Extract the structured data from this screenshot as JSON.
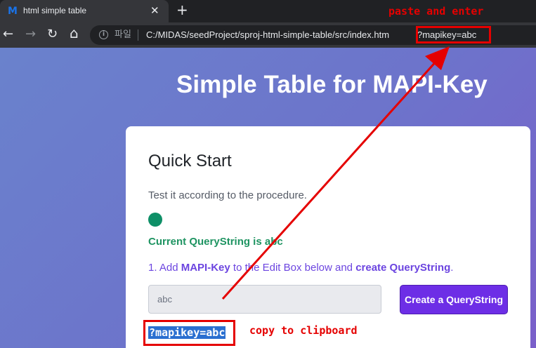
{
  "browser": {
    "tab_logo": "M",
    "tab_title": "html simple table",
    "tab_close": "✕",
    "new_tab": "+",
    "back": "←",
    "forward": "→",
    "reload": "↻",
    "home": "⌂",
    "info": "i",
    "file_label": "파일",
    "url": "C:/MIDAS/seedProject/sproj-html-simple-table/src/index.htm",
    "url_query": "?mapikey=abc"
  },
  "annotations": {
    "paste": "paste and enter",
    "copy": "copy to clipboard",
    "color": "#e50000"
  },
  "page": {
    "heading": "Simple Table for MAPI-Key",
    "card": {
      "title": "Quick Start",
      "description": "Test it according to the procedure.",
      "status_color": "#0e8f67",
      "current_querystring": "Current QueryString is abc",
      "step_prefix": "1. Add ",
      "step_bold1": "MAPI-Key",
      "step_middle": " to the Edit Box below and ",
      "step_bold2": "create QueryString",
      "step_suffix": ".",
      "input_value": "abc",
      "button_label": "Create a QueryString",
      "querystring_output": "?mapikey=abc"
    }
  },
  "colors": {
    "accent": "#6d2ee6",
    "success": "#1f9462",
    "highlight": "#2a6fd0"
  }
}
